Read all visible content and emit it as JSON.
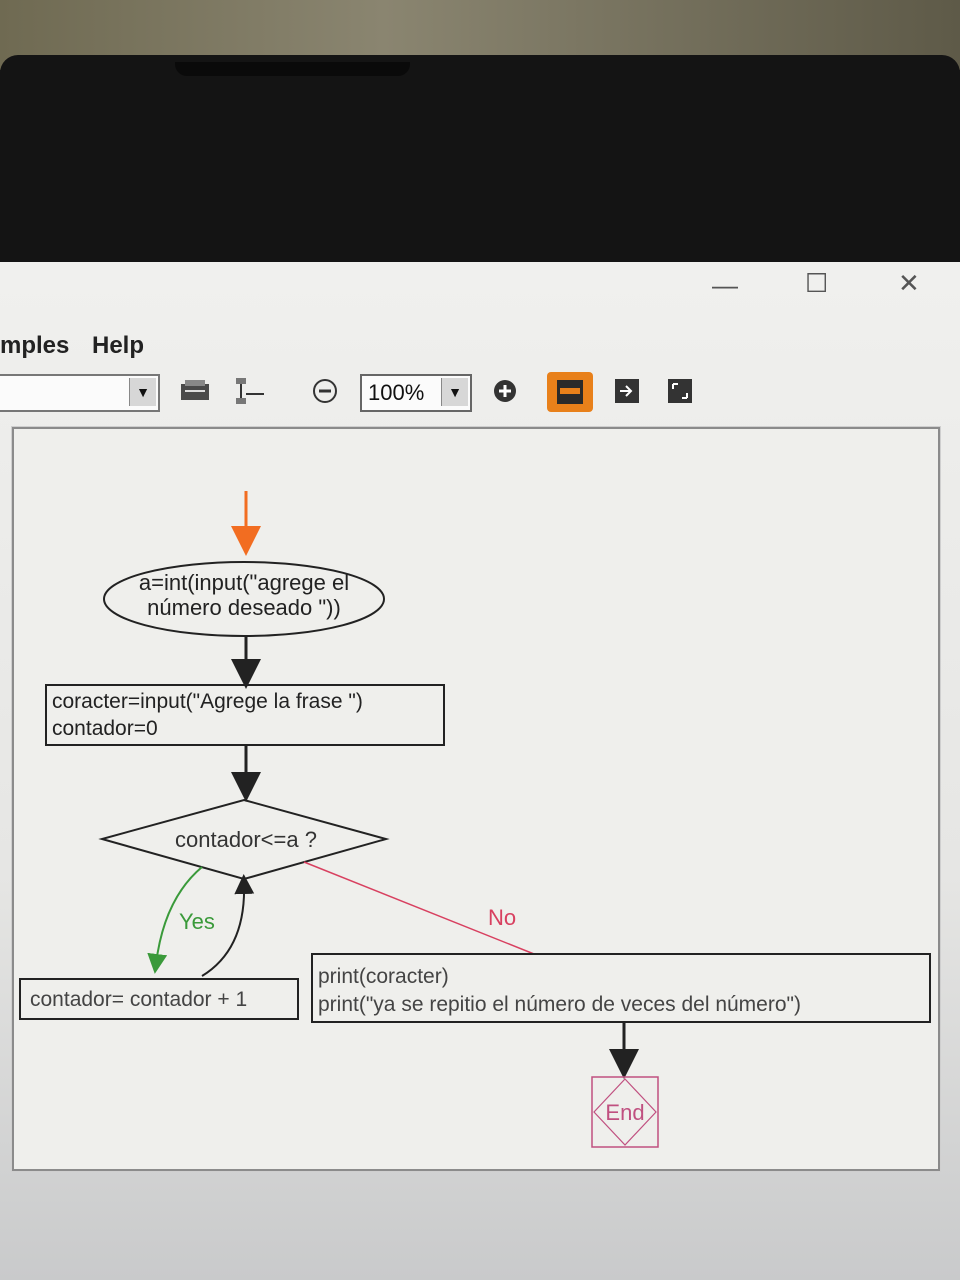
{
  "window": {
    "minimize": "—",
    "maximize": "☐",
    "close": "✕"
  },
  "menu": [
    {
      "label": "mples"
    },
    {
      "label": "Help"
    }
  ],
  "toolbar": {
    "zoom_value": "100%",
    "combo_arrow": "▼",
    "zoom_arrow": "▼"
  },
  "flowchart": {
    "input_line1": "a=int(input(\"agrege el",
    "input_line2": "número deseado \"))",
    "assign_line1": "coracter=input(\"Agrege la frase \")",
    "assign_line2": "contador=0",
    "decision": "contador<=a ?",
    "yes": "Yes",
    "no": "No",
    "increment": "contador= contador + 1",
    "output_line1": "print(coracter)",
    "output_line2": "print(\"ya se repitio el número de veces del número\")",
    "end": "End"
  },
  "colors": {
    "start_arrow": "#f26d21",
    "flow": "#222222",
    "yes": "#3a9a3a",
    "no": "#d84060",
    "end": "#c05080",
    "accent": "#e8801a"
  }
}
